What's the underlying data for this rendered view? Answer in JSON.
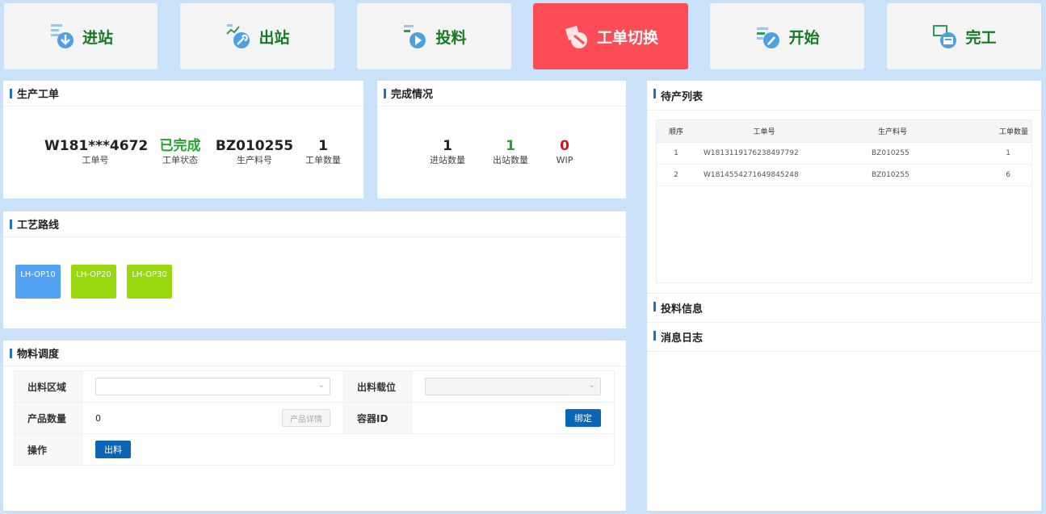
{
  "toolbar": {
    "buttons": [
      {
        "label": "进站",
        "icon": "enter-station-icon"
      },
      {
        "label": "出站",
        "icon": "exit-station-icon"
      },
      {
        "label": "投料",
        "icon": "feed-material-icon"
      },
      {
        "label": "工单切换",
        "icon": "work-order-switch-icon"
      },
      {
        "label": "开始",
        "icon": "start-icon"
      },
      {
        "label": "完工",
        "icon": "complete-icon"
      }
    ],
    "active_color": "#fc4c56",
    "label_color": "#157b22"
  },
  "production_order": {
    "title": "生产工单",
    "order_no": {
      "value": "W181***4672",
      "label": "工单号"
    },
    "status": {
      "value": "已完成",
      "label": "工单状态",
      "color": "#2aa12f"
    },
    "material_no": {
      "value": "BZ010255",
      "label": "生产料号"
    },
    "quantity": {
      "value": "1",
      "label": "工单数量"
    }
  },
  "completion": {
    "title": "完成情况",
    "in_count": {
      "value": "1",
      "label": "进站数量"
    },
    "out_count": {
      "value": "1",
      "label": "出站数量",
      "color": "#2aa12f"
    },
    "wip": {
      "value": "0",
      "label": "WIP",
      "color": "#d0131b"
    }
  },
  "route": {
    "title": "工艺路线",
    "ops": [
      {
        "label": "LH-OP10",
        "color": "#52a3f6"
      },
      {
        "label": "LH-OP20",
        "color": "#98d80f"
      },
      {
        "label": "LH-OP30",
        "color": "#98d80f"
      }
    ]
  },
  "material": {
    "title": "物料调度",
    "out_area_label": "出料区域",
    "out_slot_label": "出料载位",
    "qty_label": "产品数量",
    "qty_value": "0",
    "detail_button": "产品详情",
    "container_label": "容器ID",
    "bind_button": "绑定",
    "op_label": "操作",
    "out_button": "出料"
  },
  "pending": {
    "title": "待产列表",
    "columns": [
      "顺序",
      "工单号",
      "生产料号",
      "工单数量"
    ],
    "rows": [
      [
        "1",
        "W1813119176238497792",
        "BZ010255",
        "1"
      ],
      [
        "2",
        "W1814554271649845248",
        "BZ010255",
        "6"
      ]
    ]
  },
  "feed_info": {
    "title": "投料信息"
  },
  "message_log": {
    "title": "消息日志"
  }
}
